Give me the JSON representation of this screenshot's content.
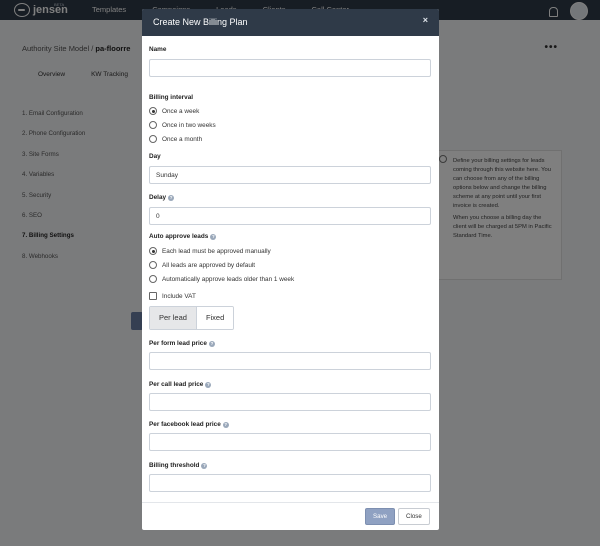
{
  "app": {
    "logo_text": "jensen",
    "logo_badge": "BETA",
    "nav": [
      "Templates",
      "Campaigns",
      "Leads",
      "Clients",
      "Call Center"
    ]
  },
  "page": {
    "breadcrumb_site": "Authority Site Model",
    "breadcrumb_sep": "/",
    "breadcrumb_current": "pa-floorre",
    "tabs": [
      "Overview",
      "KW Tracking"
    ],
    "sidebar": [
      "1. Email Configuration",
      "2. Phone Configuration",
      "3. Site Forms",
      "4. Variables",
      "5. Security",
      "6. SEO",
      "7. Billing Settings",
      "8. Webhooks"
    ],
    "active_sidebar_index": 6,
    "help_text_1": "Define your billing settings for leads coming through this website here. You can choose from any of the billing options below and change the billing scheme at any point until your first invoice is created.",
    "help_text_2": "When you choose a billing day the client will be charged at 5PM in Pacific Standard Time."
  },
  "modal": {
    "title": "Create New Billing Plan",
    "close_symbol": "×",
    "name_label": "Name",
    "name_value": "",
    "billing_interval_label": "Billing interval",
    "billing_interval_options": [
      "Once a week",
      "Once in two weeks",
      "Once a month"
    ],
    "billing_interval_selected": "Once a week",
    "day_label": "Day",
    "day_value": "Sunday",
    "delay_label": "Delay",
    "delay_value": "0",
    "auto_approve_label": "Auto approve leads",
    "auto_approve_options": [
      "Each lead must be approved manually",
      "All leads are approved by default",
      "Automatically approve leads older than 1 week"
    ],
    "auto_approve_selected": "Each lead must be approved manually",
    "include_vat_label": "Include VAT",
    "include_vat_checked": false,
    "pricing_toggle": [
      "Per lead",
      "Fixed"
    ],
    "pricing_selected": "Per lead",
    "per_form_label": "Per form lead price",
    "per_form_value": "",
    "per_call_label": "Per call lead price",
    "per_call_value": "",
    "per_facebook_label": "Per facebook lead price",
    "per_facebook_value": "",
    "threshold_label": "Billing threshold",
    "threshold_value": "",
    "help_symbol": "?",
    "save_label": "Save",
    "close_label": "Close"
  },
  "colors": {
    "header_bg": "#2f3a48",
    "save_button": "#8fa1c2",
    "toggle_active_bg": "#e6e7e9"
  }
}
